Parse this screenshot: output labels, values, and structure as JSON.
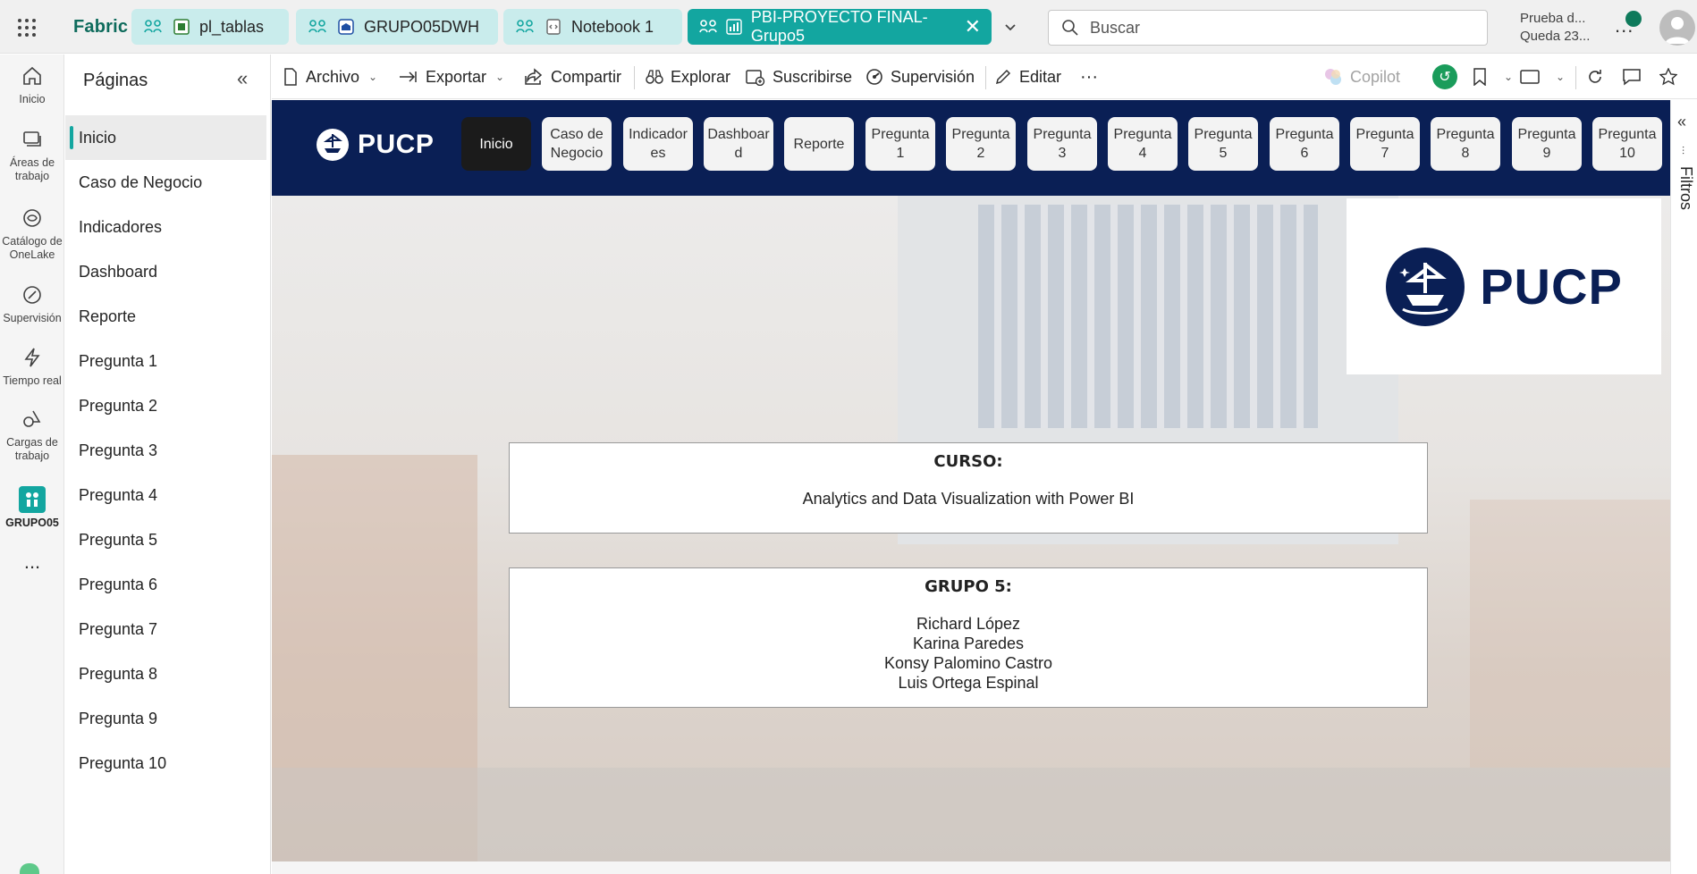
{
  "app": {
    "brand": "Fabric",
    "tabs": [
      {
        "label": "pl_tablas",
        "icon": "pipeline-icon"
      },
      {
        "label": "GRUPO05DWH",
        "icon": "warehouse-icon"
      },
      {
        "label": "Notebook 1",
        "icon": "notebook-icon"
      },
      {
        "label": "PBI-PROYECTO FINAL-Grupo5",
        "icon": "report-icon",
        "active": true
      }
    ],
    "search_placeholder": "Buscar",
    "trial_line1": "Prueba d...",
    "trial_line2": "Queda 23...",
    "more": "..."
  },
  "rail": {
    "items": [
      {
        "label": "Inicio",
        "icon": "home-icon"
      },
      {
        "label": "Áreas de trabajo",
        "icon": "workspaces-icon"
      },
      {
        "label": "Catálogo de OneLake",
        "icon": "onelake-catalog-icon"
      },
      {
        "label": "Supervisión",
        "icon": "monitor-icon"
      },
      {
        "label": "Tiempo real",
        "icon": "lightning-icon"
      },
      {
        "label": "Cargas de trabajo",
        "icon": "workloads-icon"
      },
      {
        "label": "GRUPO05",
        "icon": "workspace-group-icon"
      }
    ],
    "more": "..."
  },
  "pages": {
    "title": "Páginas",
    "items": [
      "Inicio",
      "Caso de Negocio",
      "Indicadores",
      "Dashboard",
      "Reporte",
      "Pregunta 1",
      "Pregunta 2",
      "Pregunta 3",
      "Pregunta 4",
      "Pregunta 5",
      "Pregunta 6",
      "Pregunta 7",
      "Pregunta 8",
      "Pregunta 9",
      "Pregunta 10"
    ],
    "active": "Inicio"
  },
  "toolbar": {
    "archivo": "Archivo",
    "exportar": "Exportar",
    "compartir": "Compartir",
    "explorar": "Explorar",
    "suscribirse": "Suscribirse",
    "supervision": "Supervisión",
    "editar": "Editar",
    "more": "···",
    "copilot": "Copilot"
  },
  "report": {
    "nav_logo": "PUCP",
    "nav_buttons": [
      {
        "label": "Inicio",
        "active": true
      },
      {
        "label": "Caso de Negocio"
      },
      {
        "label": "Indicador es"
      },
      {
        "label": "Dashboar d"
      },
      {
        "label": "Reporte"
      },
      {
        "label": "Pregunta 1"
      },
      {
        "label": "Pregunta 2"
      },
      {
        "label": "Pregunta 3"
      },
      {
        "label": "Pregunta 4"
      },
      {
        "label": "Pregunta 5"
      },
      {
        "label": "Pregunta 6"
      },
      {
        "label": "Pregunta 7"
      },
      {
        "label": "Pregunta 8"
      },
      {
        "label": "Pregunta 9"
      },
      {
        "label": "Pregunta 10"
      }
    ],
    "logo_text": "PUCP",
    "course_heading": "CURSO:",
    "course_name": "Analytics and Data Visualization with Power BI",
    "group_heading": "GRUPO 5:",
    "members": [
      "Richard López",
      "Karina Paredes",
      "Konsy Palomino Castro",
      "Luis Ortega Espinal"
    ]
  },
  "filters": {
    "label": "Filtros"
  },
  "colors": {
    "accent": "#13a6a0",
    "nav_band": "#0a1f55",
    "brand": "#0e6b5c"
  }
}
